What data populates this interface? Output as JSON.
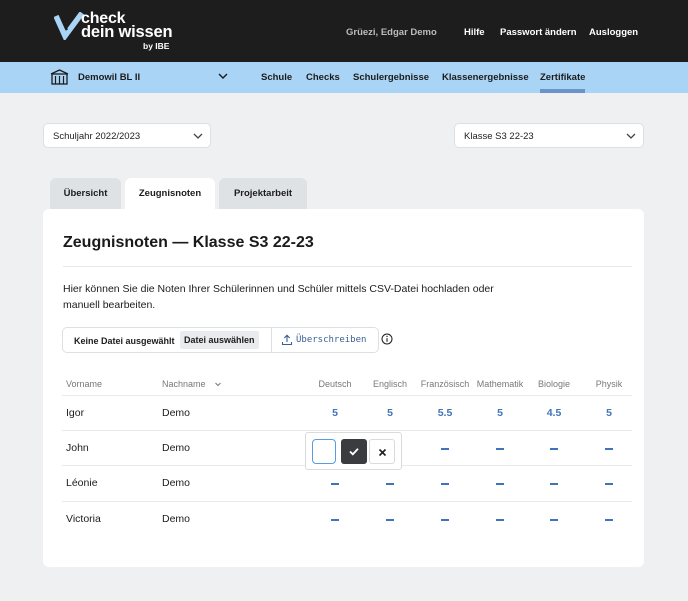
{
  "header": {
    "logo_line1": "check",
    "logo_line2": "dein wissen",
    "logo_line3": "by IBE",
    "greeting": "Grüezi, Edgar Demo",
    "links": [
      "Hilfe",
      "Passwort ändern",
      "Ausloggen"
    ]
  },
  "subnav": {
    "school": "Demowil BL II",
    "links": [
      "Schule",
      "Checks",
      "Schulergebnisse",
      "Klassenergebnisse",
      "Zertifikate"
    ],
    "active": "Zertifikate"
  },
  "filters": {
    "year": "Schuljahr 2022/2023",
    "class": "Klasse S3 22-23"
  },
  "tabs": [
    "Übersicht",
    "Zeugnisnoten",
    "Projektarbeit"
  ],
  "active_tab": "Zeugnisnoten",
  "card": {
    "title": "Zeugnisnoten — Klasse S3 22-23",
    "description": "Hier können Sie die Noten Ihrer Schülerinnen und Schüler mittels CSV-Datei hochladen oder manuell bearbeiten.",
    "no_file": "Keine Datei ausgewählt",
    "choose_file": "Datei auswählen",
    "overwrite": "Überschreiben"
  },
  "table": {
    "columns": {
      "vorname": "Vorname",
      "nachname": "Nachname",
      "subjects": [
        "Deutsch",
        "Englisch",
        "Französisch",
        "Mathematik",
        "Biologie",
        "Physik"
      ]
    },
    "rows": [
      {
        "vorname": "Igor",
        "nachname": "Demo",
        "grades": [
          "5",
          "5",
          "5.5",
          "5",
          "4.5",
          "5"
        ]
      },
      {
        "vorname": "John",
        "nachname": "Demo",
        "grades": [
          null,
          null,
          null,
          null,
          null,
          null
        ]
      },
      {
        "vorname": "Léonie",
        "nachname": "Demo",
        "grades": [
          null,
          null,
          null,
          null,
          null,
          null
        ]
      },
      {
        "vorname": "Victoria",
        "nachname": "Demo",
        "grades": [
          null,
          null,
          null,
          null,
          null,
          null
        ]
      }
    ],
    "editor": {
      "row": "John",
      "value": ""
    }
  },
  "colors": {
    "topbar": "#1d1d1d",
    "subnav": "#a9d4f5",
    "accent": "#3f74b8",
    "background": "#eef0f2"
  }
}
